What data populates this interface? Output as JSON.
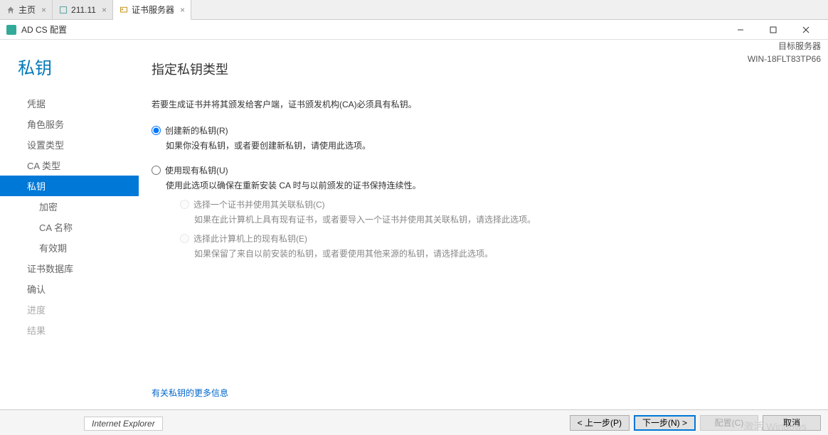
{
  "tabs": {
    "home": "主页",
    "ip": "211.11",
    "cert": "证书服务器"
  },
  "window": {
    "title": "AD CS 配置"
  },
  "page_title": "私钥",
  "target_server": {
    "label": "目标服务器",
    "name": "WIN-18FLT83TP66"
  },
  "nav": {
    "credentials": "凭据",
    "role_services": "角色服务",
    "setup_type": "设置类型",
    "ca_type": "CA 类型",
    "private_key": "私钥",
    "crypto": "加密",
    "ca_name": "CA 名称",
    "validity": "有效期",
    "cert_db": "证书数据库",
    "confirm": "确认",
    "progress": "进度",
    "result": "结果"
  },
  "main": {
    "section_title": "指定私钥类型",
    "intro": "若要生成证书并将其颁发给客户端，证书颁发机构(CA)必须具有私钥。",
    "opt_new": {
      "label": "创建新的私钥(R)",
      "desc": "如果你没有私钥，或者要创建新私钥，请使用此选项。"
    },
    "opt_existing": {
      "label": "使用现有私钥(U)",
      "desc": "使用此选项以确保在重新安装 CA 时与以前颁发的证书保持连续性。"
    },
    "sub_cert": {
      "label": "选择一个证书并使用其关联私钥(C)",
      "desc": "如果在此计算机上具有现有证书，或者要导入一个证书并使用其关联私钥，请选择此选项。"
    },
    "sub_existing": {
      "label": "选择此计算机上的现有私钥(E)",
      "desc": "如果保留了来自以前安装的私钥，或者要使用其他来源的私钥，请选择此选项。"
    },
    "more_link": "有关私钥的更多信息"
  },
  "footer": {
    "prev": "< 上一步(P)",
    "next": "下一步(N) >",
    "config": "配置(C)",
    "cancel": "取消"
  },
  "ie_badge": "Internet Explorer",
  "watermark": {
    "line1": "激活 Windows",
    "line2": ""
  }
}
